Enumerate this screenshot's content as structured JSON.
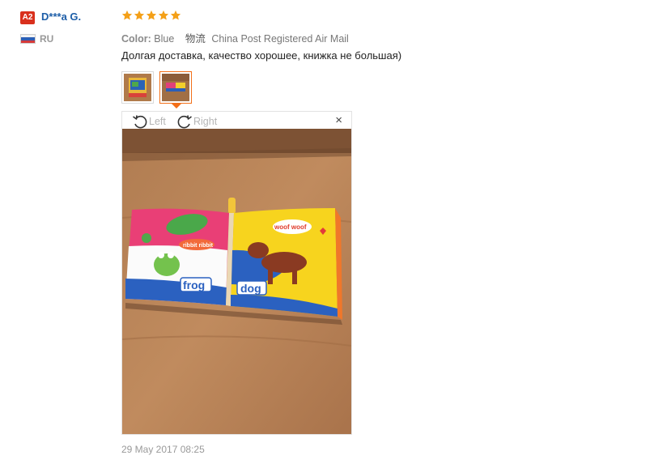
{
  "user": {
    "badge": "A2",
    "name": "D***a G.",
    "country": "RU",
    "flag_icon": "russia-flag-icon"
  },
  "review": {
    "rating": 5,
    "rating_max": 5,
    "star_color": "#f4a018",
    "color_label": "Color:",
    "color_value": "Blue",
    "shipping_label": "物流",
    "shipping_value": "China Post Registered Air Mail",
    "feedback": "Долгая доставка, качество хорошее, книжка не большая)",
    "date": "29 May 2017 08:25"
  },
  "gallery": {
    "thumbnail_count": 2,
    "selected_index": 1,
    "selected_border_color": "#f36f18"
  },
  "viewer": {
    "rotate_left_label": "Left",
    "rotate_right_label": "Right",
    "close_label": "×",
    "book_left_page_label": "frog",
    "book_right_page_label": "dog",
    "bubble_left_text": "ribbit ribbit",
    "bubble_right_text": "woof woof"
  }
}
